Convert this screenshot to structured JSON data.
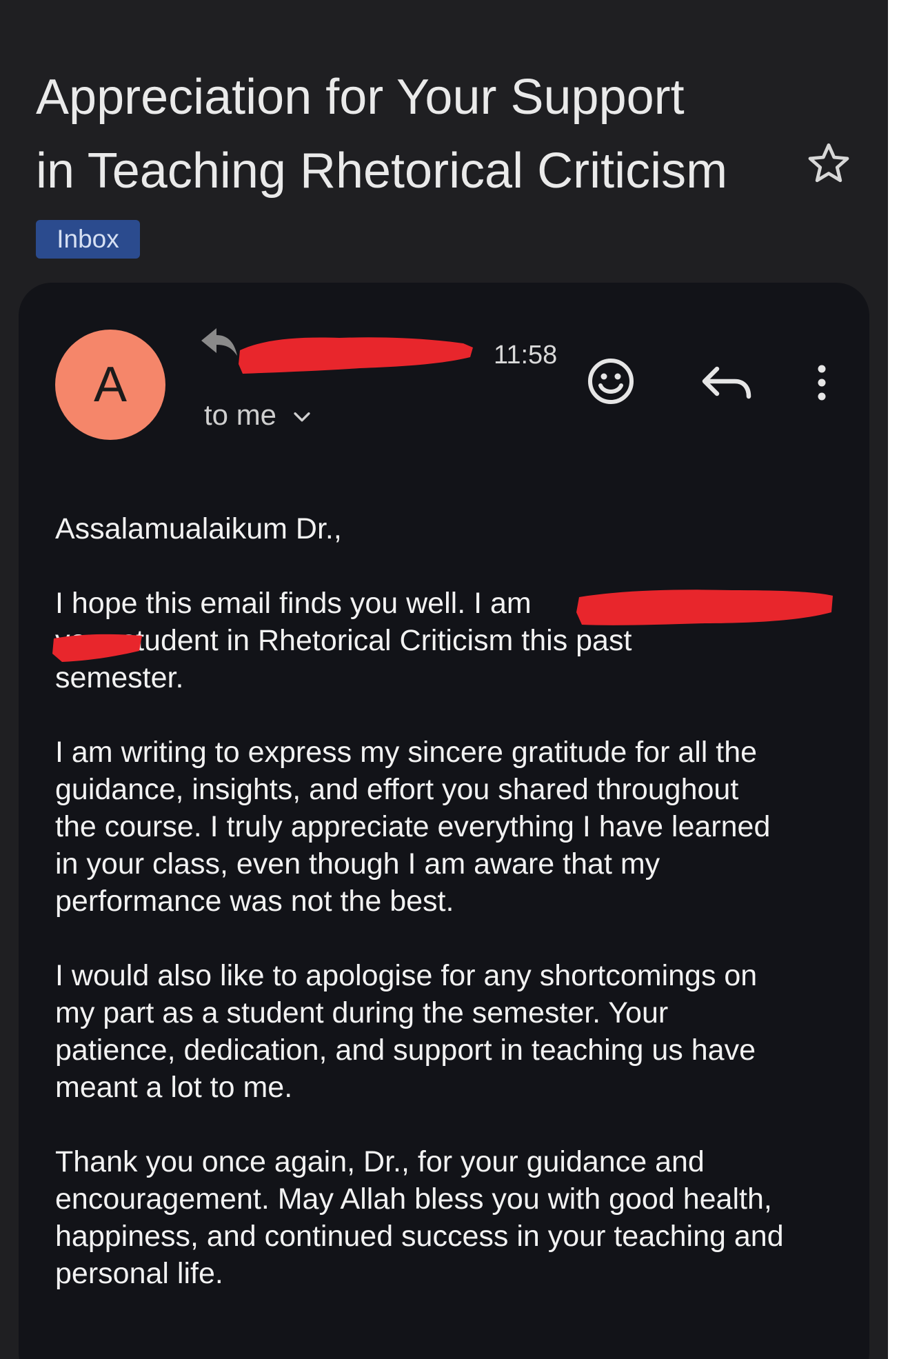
{
  "email": {
    "subject": "Appreciation for Your Support\nin Teaching Rhetorical Criticism",
    "label": "Inbox",
    "avatar_letter": "A",
    "sender": "",
    "time": "11:58",
    "recipient": "to me",
    "body": {
      "greeting": "Assalamualaikum Dr.,",
      "p1": "I hope this email finds you well. I am\nyour student in Rhetorical Criticism this past\nsemester.",
      "p2": "I am writing to express my sincere gratitude for all the\nguidance, insights, and effort you shared throughout\nthe course. I truly appreciate everything I have learned\nin your class, even though I am aware that my\nperformance was not the best.",
      "p3": "I would also like to apologise for any shortcomings on\nmy part as a student during the semester. Your\npatience, dedication, and support in teaching us have\nmeant a lot to me.",
      "p4": "Thank you once again, Dr., for your guidance and\nencouragement. May Allah bless you with good health,\nhappiness, and continued success in your teaching and\npersonal life."
    }
  },
  "icons": {
    "star": "star-outline-icon",
    "reply_indicator": "reply-arrow-icon",
    "emoji": "smiley-face-icon",
    "reply": "reply-icon",
    "more": "more-vertical-icon",
    "recipient_toggle": "chevron-down-icon"
  },
  "colors": {
    "page_background": "#1f1f22",
    "card_background": "#121318",
    "text_primary": "#f2f2f2",
    "label_background": "#2b4b8e",
    "avatar_background": "#f5866a",
    "redaction": "#e8262c"
  }
}
